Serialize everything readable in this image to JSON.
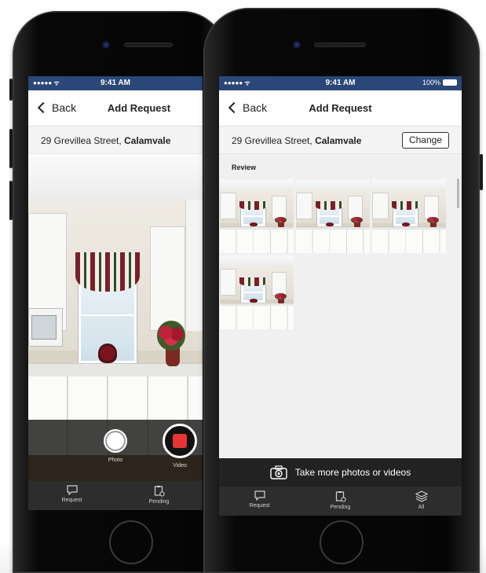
{
  "left_phone": {
    "status": {
      "signal": "●●●●● ᯤ",
      "time": "9:41 AM"
    },
    "nav": {
      "back_label": "Back",
      "title": "Add Request"
    },
    "address": {
      "street": "29 Grevillea Street, ",
      "suburb": "Calamvale"
    },
    "camera": {
      "photo_label": "Photo",
      "video_label": "Video"
    },
    "tabs": [
      {
        "label": "Request",
        "icon": "speech-bubble-icon"
      },
      {
        "label": "Pending",
        "icon": "clipboard-clock-icon"
      }
    ]
  },
  "right_phone": {
    "status": {
      "signal": "●●●●● ᯤ",
      "time": "9:41 AM",
      "battery": "100%"
    },
    "nav": {
      "back_label": "Back",
      "title": "Add Request"
    },
    "address": {
      "street": "29 Grevillea Street, ",
      "suburb": "Calamvale",
      "change_label": "Change"
    },
    "review_label": "Review",
    "thumbnail_count": 4,
    "action_label": "Take more photos or videos",
    "tabs": [
      {
        "label": "Request",
        "icon": "speech-bubble-icon"
      },
      {
        "label": "Pending",
        "icon": "clipboard-clock-icon"
      },
      {
        "label": "All",
        "icon": "layers-icon"
      }
    ]
  },
  "colors": {
    "status_bar": "#2b4777",
    "tab_bar": "#2d2d2d",
    "record": "#e53535"
  }
}
